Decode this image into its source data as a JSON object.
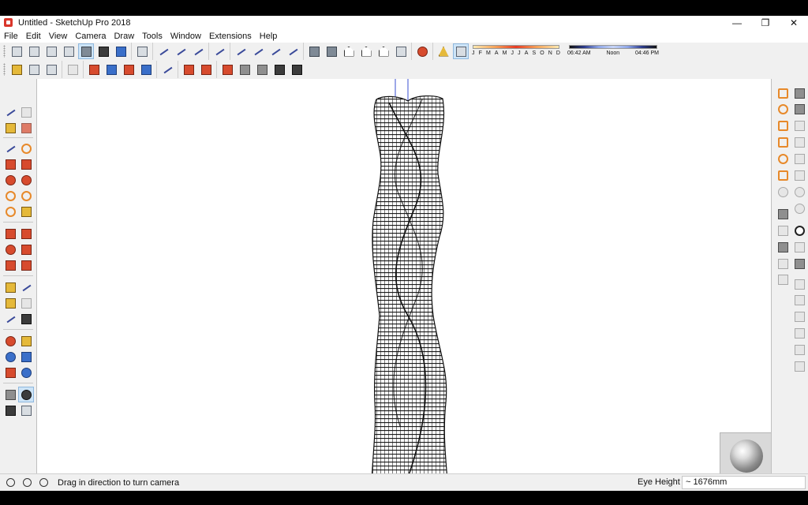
{
  "window": {
    "title": "Untitled - SketchUp Pro 2018",
    "controls": {
      "minimize": "—",
      "maximize": "❐",
      "close": "✕"
    }
  },
  "menu": [
    "File",
    "Edit",
    "View",
    "Camera",
    "Draw",
    "Tools",
    "Window",
    "Extensions",
    "Help"
  ],
  "shadow": {
    "months": [
      "J",
      "F",
      "M",
      "A",
      "M",
      "J",
      "J",
      "A",
      "S",
      "O",
      "N",
      "D"
    ],
    "time_start": "06:42 AM",
    "time_mid": "Noon",
    "time_end": "04:46 PM"
  },
  "status": {
    "message": "Drag in direction to turn camera",
    "vcb_label": "Eye Height",
    "vcb_value": "~ 1676mm"
  },
  "colors": {
    "axis_green": "#3aa34a",
    "axis_red": "#d0352b",
    "axis_blue": "#3a4fd0",
    "tower_lines": "#1a1a1a"
  }
}
